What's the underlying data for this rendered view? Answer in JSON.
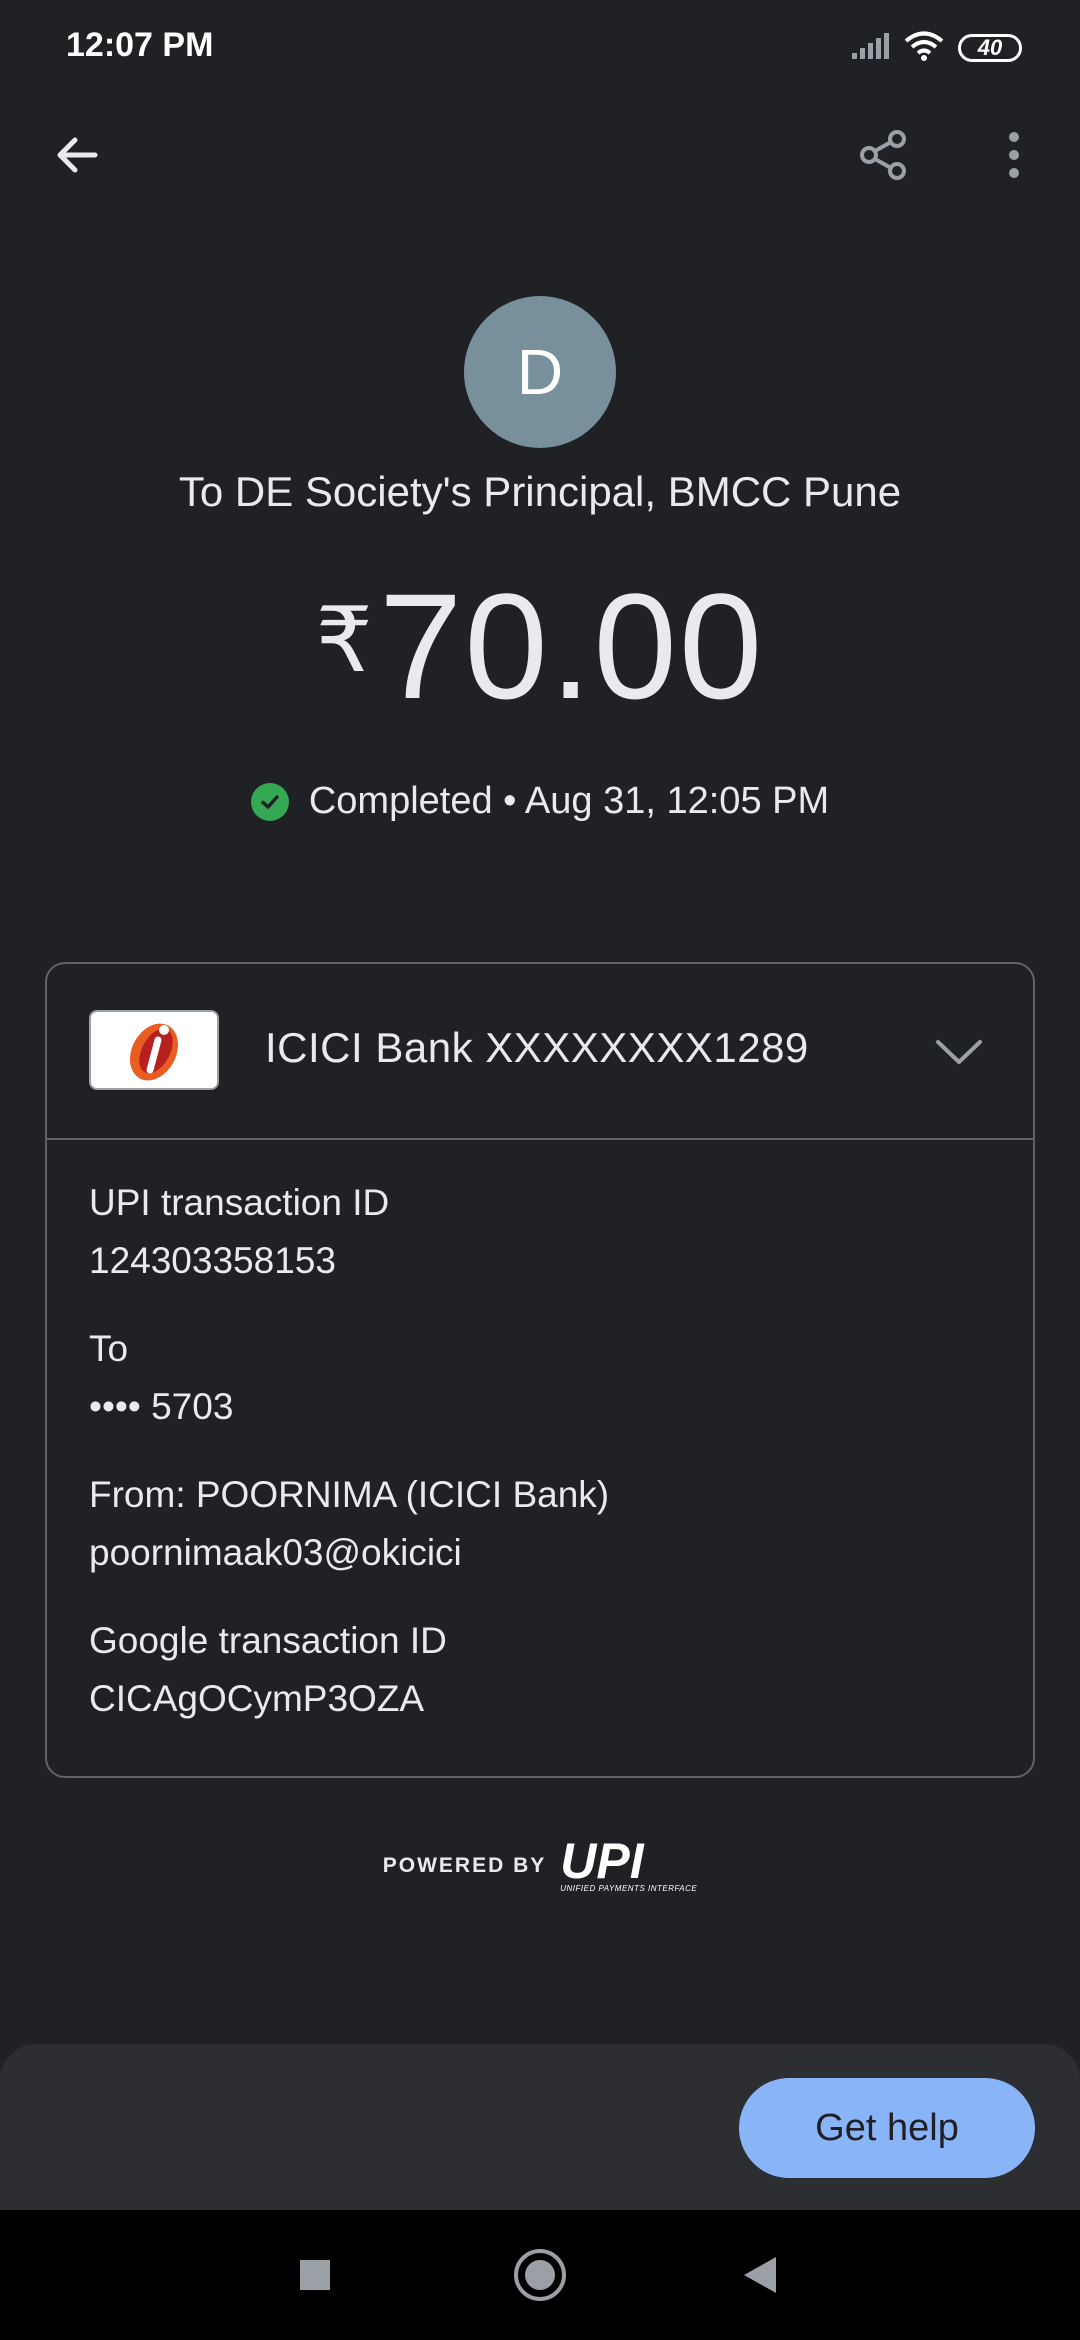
{
  "status_bar": {
    "time": "12:07 PM",
    "battery": "40"
  },
  "appbar": {
    "back_icon": "arrow-back-icon",
    "share_icon": "share-icon",
    "more_icon": "more-vert-icon"
  },
  "payee": {
    "avatar_initial": "D",
    "avatar_color": "#78909c",
    "recipient_line": "To DE Society's Principal, BMCC Pune"
  },
  "payment": {
    "currency_symbol": "₹",
    "amount": "70.00",
    "status_text": "Completed • Aug 31, 12:05 PM",
    "status_color": "#34a853"
  },
  "account_card": {
    "bank_account": "ICICI Bank XXXXXXXX1289",
    "details": [
      {
        "label": "UPI transaction ID",
        "value": "124303358153"
      },
      {
        "label": "To",
        "value": "•••• 5703"
      },
      {
        "label": "From: POORNIMA  (ICICI Bank)",
        "value": "poornimaak03@okicici"
      },
      {
        "label": "Google transaction ID",
        "value": "CICAgOCymP3OZA"
      }
    ]
  },
  "footer": {
    "powered_by": "POWERED BY",
    "upi_logo": "UPI",
    "upi_tagline": "UNIFIED PAYMENTS INTERFACE"
  },
  "bottom_sheet": {
    "help_label": "Get help",
    "accent": "#8ab4f8"
  }
}
